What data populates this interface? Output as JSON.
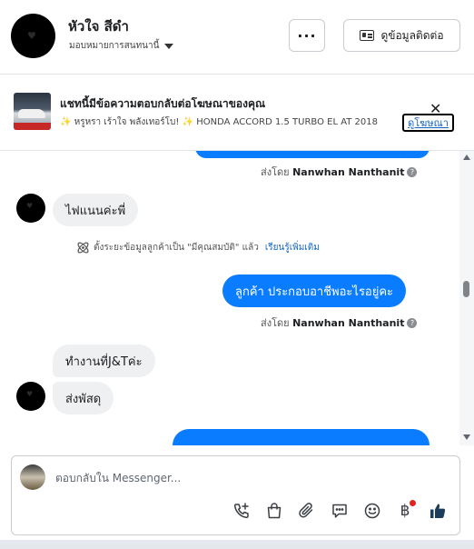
{
  "header": {
    "contact_name": "หัวใจ สีดำ",
    "assign_label": "มอบหมายการสนทนานี้",
    "more_label": "···",
    "contact_info_label": "ดูข้อมูลติดต่อ"
  },
  "ad": {
    "title": "แชทนี้มีข้อความตอบกลับต่อโฆษณาของคุณ",
    "subtitle": "✨ หรูหรา เร้าใจ พลังเทอร์โบ! ✨ HONDA ACCORD 1.5 TURBO EL AT 2018",
    "view_ad_label": "ดูโฆษณา",
    "close_label": "✕"
  },
  "thread": {
    "sent_by_prefix": "ส่งโดย",
    "agent_name": "Nanwhan Nanthanit",
    "messages": [
      {
        "from": "contact",
        "text": "ไฟแนนค่ะพี่"
      },
      {
        "from": "agent",
        "text": "ลูกค้า  ประกอบอาชีพอะไรอยู่คะ"
      },
      {
        "from": "contact",
        "text": "ทำงานที่J&Tค่ะ"
      },
      {
        "from": "contact",
        "text": "ส่งพัสดุ"
      }
    ],
    "system_note": "ตั้งระยะข้อมูลลูกค้าเป็น \"มีคุณสมบัติ\" แล้ว",
    "learn_more": "เรียนรู้เพิ่มเติม"
  },
  "composer": {
    "placeholder": "ตอบกลับใน Messenger...",
    "tools": [
      "call-add-icon",
      "shopping-bag-icon",
      "paperclip-icon",
      "chat-bubble-icon",
      "emoji-icon",
      "baht-payment-icon",
      "thumbs-up-icon"
    ],
    "baht_symbol": "฿"
  },
  "colors": {
    "outgoing_bubble": "#0a7cff",
    "incoming_bubble": "#eef0f2",
    "link": "#1565c0",
    "notification_dot": "#e02424"
  }
}
